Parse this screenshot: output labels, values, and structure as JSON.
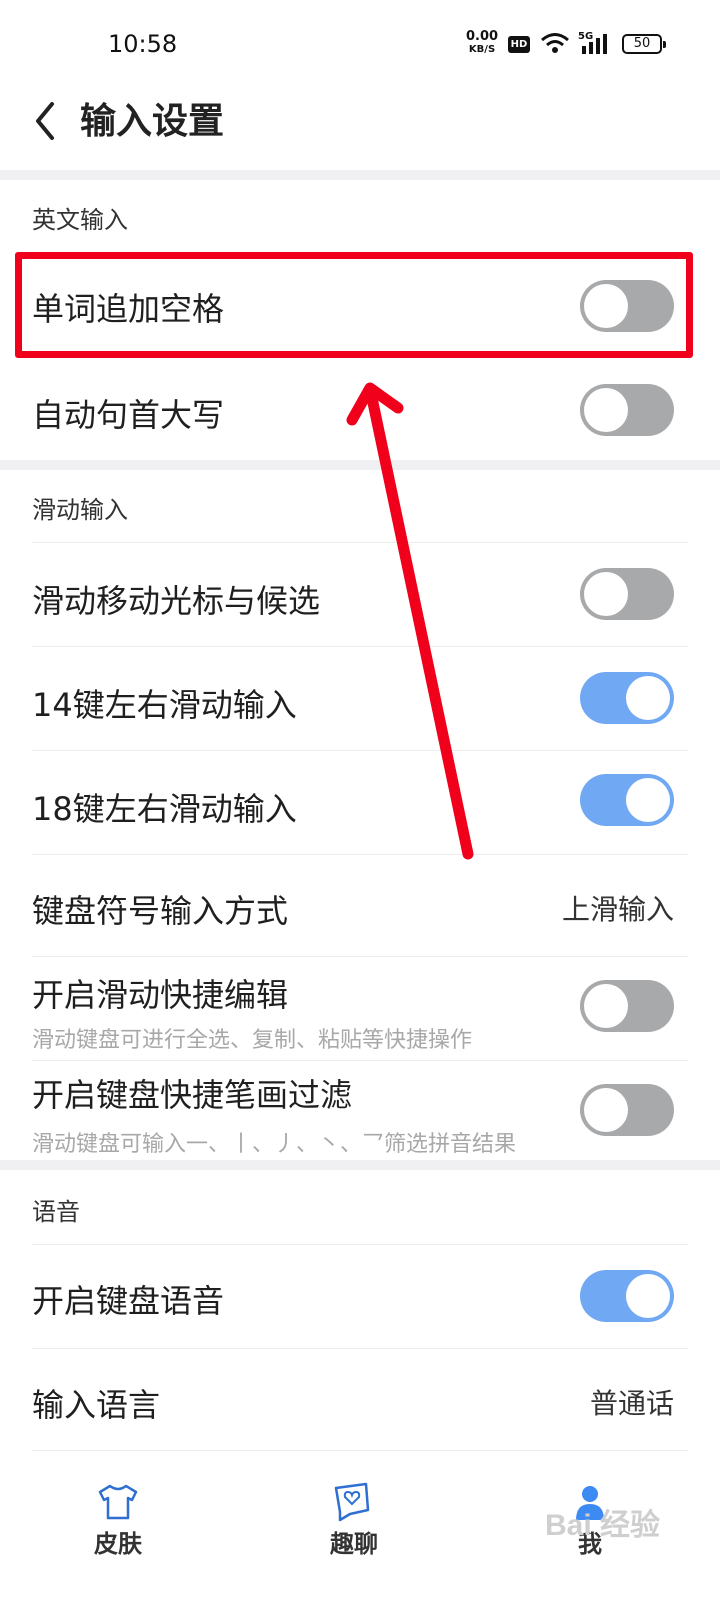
{
  "status_bar": {
    "time": "10:58",
    "net_speed_value": "0.00",
    "net_speed_unit": "KB/S",
    "hd_badge": "HD",
    "signal_label": "5G",
    "battery": "50"
  },
  "header": {
    "title": "输入设置"
  },
  "sections": {
    "english": {
      "title": "英文输入",
      "items": [
        {
          "label": "单词追加空格",
          "toggle": false
        },
        {
          "label": "自动句首大写",
          "toggle": false
        }
      ]
    },
    "slide": {
      "title": "滑动输入",
      "items": [
        {
          "label": "滑动移动光标与候选",
          "toggle": false
        },
        {
          "label": "14键左右滑动输入",
          "toggle": true
        },
        {
          "label": "18键左右滑动输入",
          "toggle": true
        },
        {
          "label": "键盘符号输入方式",
          "value": "上滑输入"
        },
        {
          "label": "开启滑动快捷编辑",
          "sub": "滑动键盘可进行全选、复制、粘贴等快捷操作",
          "toggle": false
        },
        {
          "label": "开启键盘快捷笔画过滤",
          "sub": "滑动键盘可输入一、丨、丿、丶、乛筛选拼音结果",
          "toggle": false
        }
      ]
    },
    "voice": {
      "title": "语音",
      "items": [
        {
          "label": "开启键盘语音",
          "toggle": true
        },
        {
          "label": "输入语言",
          "value": "普通话"
        }
      ]
    }
  },
  "tabbar": {
    "tabs": [
      {
        "label": "皮肤",
        "icon": "tshirt-icon"
      },
      {
        "label": "趣聊",
        "icon": "chat-heart-icon"
      },
      {
        "label": "我",
        "icon": "user-icon"
      }
    ]
  },
  "watermark": "Bai 经验",
  "colors": {
    "toggle_on": "#70a8f4",
    "toggle_off": "#a8a9ab",
    "highlight": "#f0001a"
  }
}
